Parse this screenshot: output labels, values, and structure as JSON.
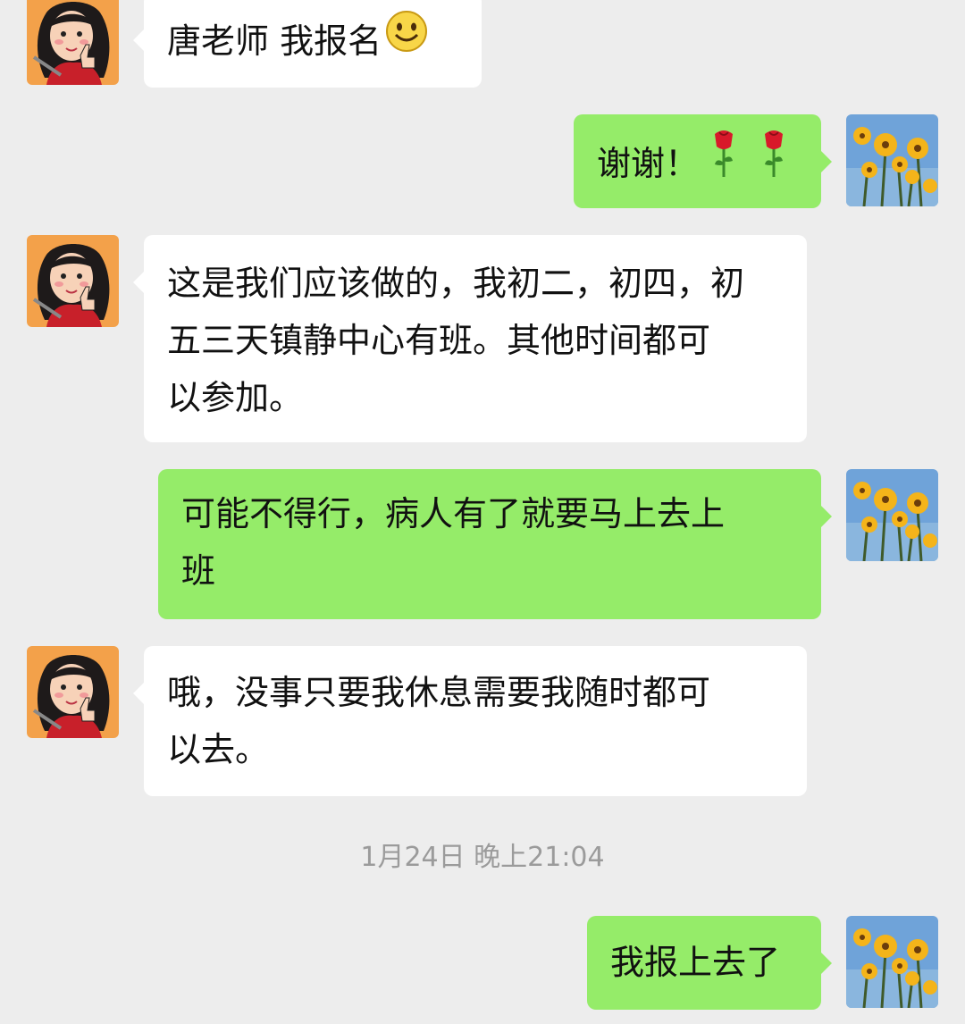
{
  "messages": [
    {
      "side": "in",
      "lines": [
        "唐老师 我报名"
      ],
      "emoji": "smile-emoji"
    },
    {
      "side": "out",
      "lines": [
        "谢谢！"
      ],
      "emoji": "rose-emoji"
    },
    {
      "side": "in",
      "lines": [
        "这是我们应该做的，我初二，初四，初",
        "五三天镇静中心有班。其他时间都可",
        "以参加。"
      ]
    },
    {
      "side": "out",
      "lines": [
        "可能不得行，病人有了就要马上去上",
        "班"
      ]
    },
    {
      "side": "in",
      "lines": [
        "哦，没事只要我休息需要我随时都可",
        "以去。"
      ]
    },
    {
      "side": "out",
      "lines": [
        "我报上去了"
      ]
    }
  ],
  "timestamp": "1月24日 晚上21:04",
  "colors": {
    "background": "#ededed",
    "incoming_bubble": "#ffffff",
    "outgoing_bubble": "#95ec69",
    "timestamp_text": "#9b9b9b"
  },
  "icons": {
    "contact_avatar": "cartoon-woman-avatar-icon",
    "self_avatar": "yellow-flowers-avatar-icon"
  }
}
